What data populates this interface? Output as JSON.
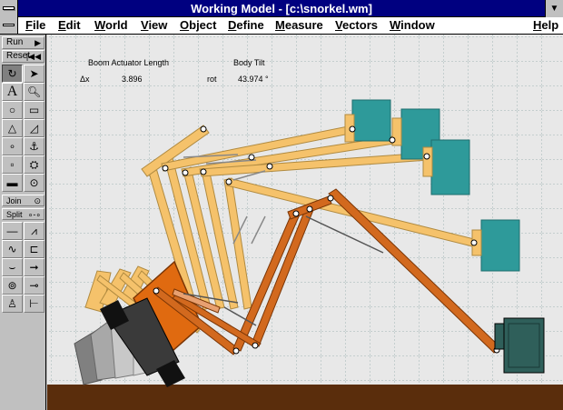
{
  "window": {
    "title": "Working Model - [c:\\snorkel.wm]"
  },
  "menu": {
    "items": [
      "File",
      "Edit",
      "World",
      "View",
      "Object",
      "Define",
      "Measure",
      "Vectors",
      "Window",
      "Help"
    ]
  },
  "palette": {
    "run_label": "Run",
    "reset_label": "Reset",
    "join_label": "Join",
    "split_label": "Split",
    "tools": [
      "rotate-icon",
      "pointer-arrow-icon",
      "text-tool-icon",
      "zoom-icon",
      "circle-icon",
      "rectangle-icon",
      "polygon-icon",
      "curved-slot-icon",
      "point-icon",
      "anchor-icon",
      "square-point-icon",
      "gear-anchor-icon",
      "rope-icon",
      "pulley-icon",
      "rod-icon",
      "spring-icon",
      "damper-icon",
      "actuator-icon",
      "curved-slot-tool-icon",
      "force-arrow-icon",
      "motor-icon",
      "torque-icon",
      "person-icon",
      "separator-icon"
    ]
  },
  "meters": {
    "actuator_title": "Boom Actuator Length",
    "actuator_axis": "Δx",
    "actuator_value": "3.896",
    "tilt_title": "Body Tilt",
    "tilt_axis": "rot",
    "tilt_value": "43.974 °"
  },
  "colors": {
    "titlebar": "#000080",
    "workspace_bg": "#e8e8e8",
    "grid": "#9fb5b5",
    "ground": "#5a2d0c",
    "boom_yellow": "#f5c26b",
    "boom_orange": "#d2691e",
    "bucket_teal": "#2e9a9a",
    "bucket_dark": "#2f5f5a"
  }
}
